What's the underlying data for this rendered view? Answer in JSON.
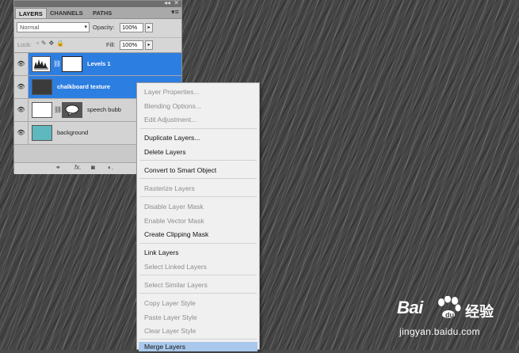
{
  "panel": {
    "tabs": [
      "LAYERS",
      "CHANNELS",
      "PATHS"
    ],
    "blend_mode": "Normal",
    "opacity_label": "Opacity:",
    "opacity_value": "100%",
    "lock_label": "Lock:",
    "fill_label": "Fill:",
    "fill_value": "100%",
    "layers": [
      {
        "name": "Levels 1",
        "selected": true
      },
      {
        "name": "chalkboard texture",
        "selected": true
      },
      {
        "name": "speech bubb",
        "selected": false
      },
      {
        "name": "background",
        "selected": false
      }
    ]
  },
  "context_menu": {
    "items": [
      {
        "label": "Layer Properties...",
        "enabled": false
      },
      {
        "label": "Blending Options...",
        "enabled": false
      },
      {
        "label": "Edit Adjustment...",
        "enabled": false
      },
      {
        "label": "Duplicate Layers...",
        "enabled": true
      },
      {
        "label": "Delete Layers",
        "enabled": true
      },
      {
        "label": "Convert to Smart Object",
        "enabled": true
      },
      {
        "label": "Rasterize Layers",
        "enabled": false
      },
      {
        "label": "Disable Layer Mask",
        "enabled": false
      },
      {
        "label": "Enable Vector Mask",
        "enabled": false
      },
      {
        "label": "Create Clipping Mask",
        "enabled": true
      },
      {
        "label": "Link Layers",
        "enabled": true
      },
      {
        "label": "Select Linked Layers",
        "enabled": false
      },
      {
        "label": "Select Similar Layers",
        "enabled": false
      },
      {
        "label": "Copy Layer Style",
        "enabled": false
      },
      {
        "label": "Paste Layer Style",
        "enabled": false
      },
      {
        "label": "Clear Layer Style",
        "enabled": false
      },
      {
        "label": "Merge Layers",
        "enabled": true,
        "highlighted": true
      }
    ]
  },
  "watermark": {
    "brand": "Bai",
    "cn": "经验",
    "url": "jingyan.baidu.com"
  },
  "colors": {
    "selection_blue": "#2d7ee1",
    "menu_highlight": "#a9c8ec",
    "background_teal": "#5fb8bd"
  }
}
